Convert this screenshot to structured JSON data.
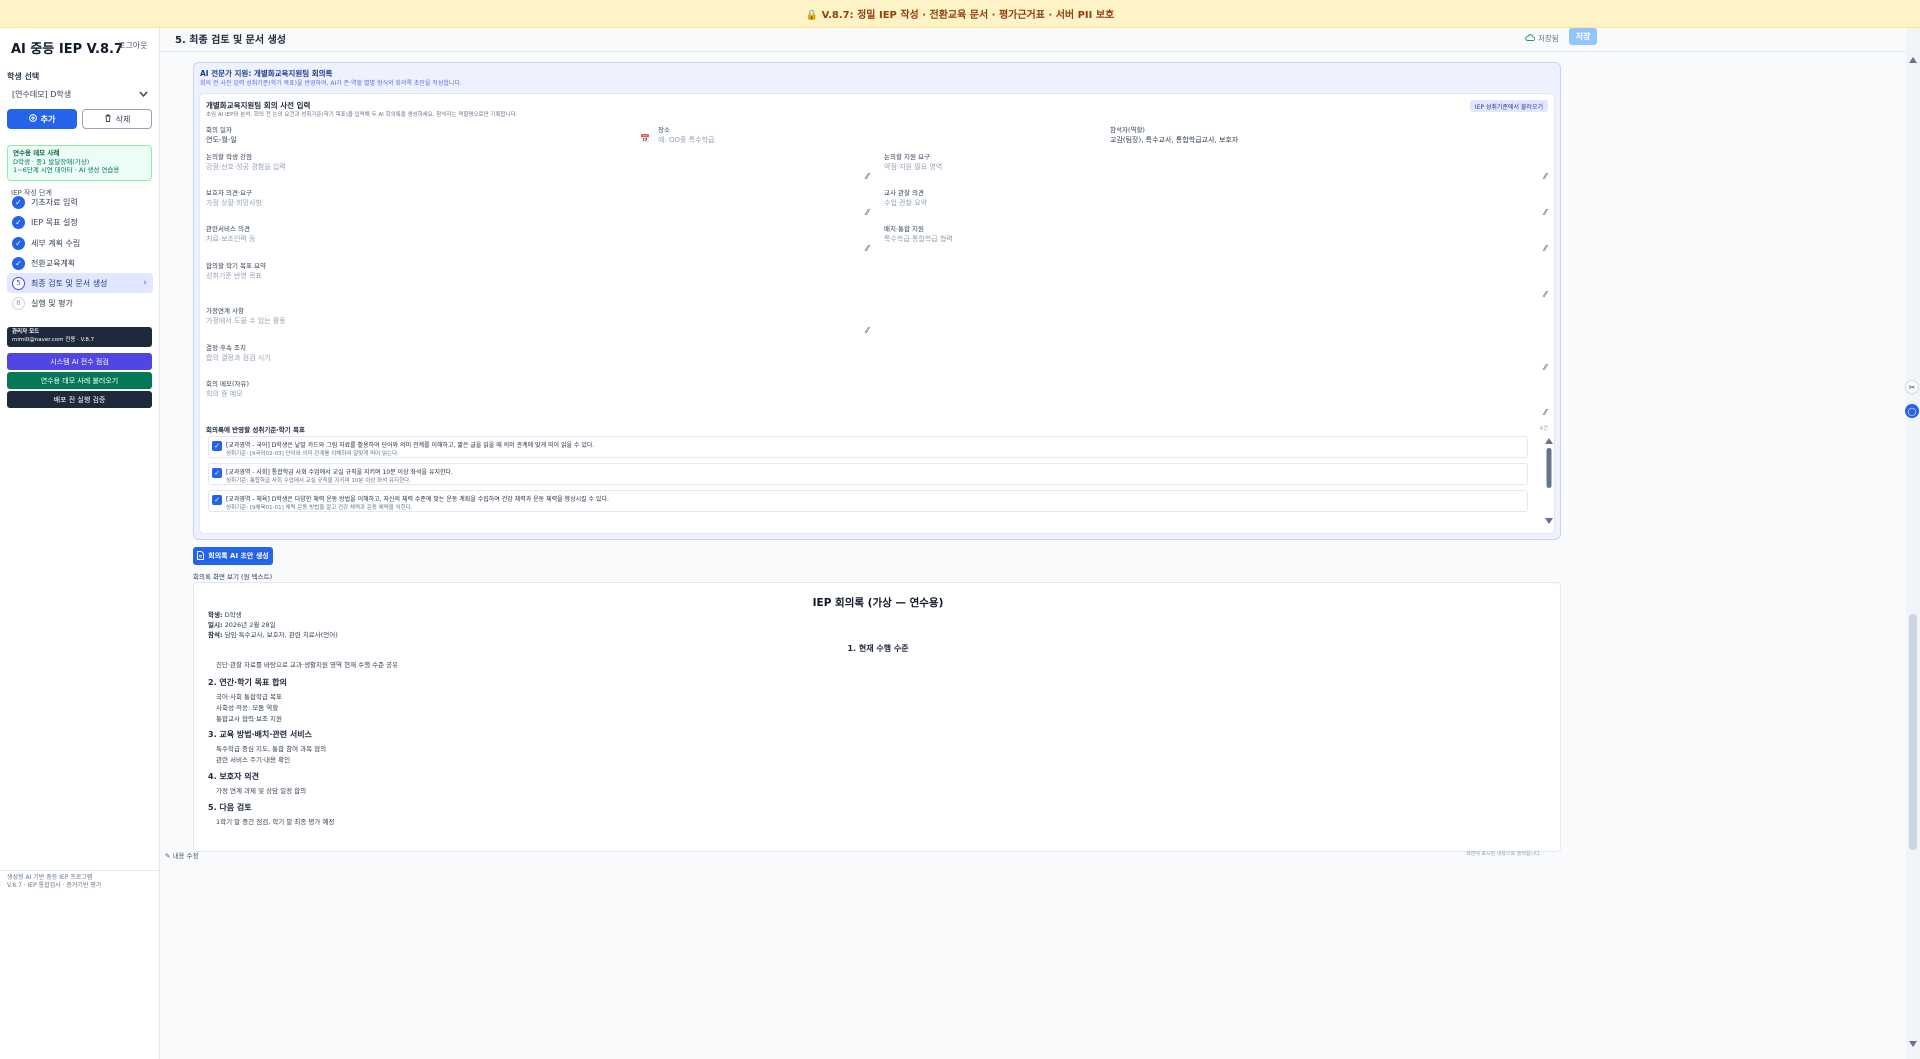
{
  "banner": {
    "text": "🔒 V.8.7: 정밀 IEP 작성 · 전환교육 문서 · 평가근거표 · 서버 PII 보호"
  },
  "sidebar": {
    "logo": "AI 중등 IEP V.8.7",
    "logout": "로그아웃",
    "student_label": "학생 선택",
    "student_value": "[연수데모] D학생",
    "add_label": "추가",
    "delete_label": "삭제",
    "demo_title": "연수용 데모 사례",
    "demo_line1": "D학생 · 중1 발달장애(가상)",
    "demo_line2": "1~6단계 시연 데이터 · AI 생성 연습용",
    "steps_label": "IEP 작성 단계",
    "steps": [
      {
        "label": "기초자료 입력",
        "num": "1"
      },
      {
        "label": "IEP 목표 설정",
        "num": "2"
      },
      {
        "label": "세부 계획 수립",
        "num": "3"
      },
      {
        "label": "전환교육계획",
        "num": "4"
      },
      {
        "label": "최종 검토 및 문서 생성",
        "num": "5"
      },
      {
        "label": "실행 및 평가",
        "num": "6"
      }
    ],
    "admin_line1": "관리자 모드",
    "admin_line2": "mimi0@naver.com 전용 · V.8.7",
    "btn_check": "시스템 AI 전수 점검",
    "btn_restore": "연수용 데모 사례 불러오기",
    "btn_test": "배포 전 실행 검증",
    "footer_line1": "생성형 AI 기반 중등 IEP 프로그램",
    "footer_line2": "V.8.7 · IEP 통합검사 · 증거기반 평가",
    "colors": {
      "primary": "#2563eb",
      "admin": "#4f46e5",
      "restore": "#047857",
      "dark": "#1e293b"
    }
  },
  "main": {
    "page_title": "5. 최종 검토 및 문서 생성",
    "saved_label": "저장됨",
    "save_button": "저장"
  },
  "assistant": {
    "title": "AI 전문가 지원: 개별화교육지원팀 회의록",
    "subtitle": "회의 전 사전 입력 성취기준(학기 목표)을 반영하여, AI가 존·역할 별별 형식의 회의록 초안을 작성합니다.",
    "card_title": "개별화교육지원팀 회의 사전 입력",
    "card_sub": "초임 AI IEP와 분석, 회의 전 논의 요건과·성취기준(학기 목표)을 입력해 두 AI 회의록을 생성하세요. 참석자는 역할명으로만 기록합니다.",
    "load_button": "IEP 성취기준에서 불러오기",
    "fields": {
      "date_label": "회의 일자",
      "date_value": "연도-월-일",
      "place_label": "장소",
      "place_placeholder": "예: OO중 특수학급",
      "attendees_label": "참석자(역할)",
      "attendees_value": "교감(팀장), 특수교사, 통합학급교사, 보호자",
      "strengths_label": "논의할 학생 강점",
      "strengths_placeholder": "강점·선호·성공 경험을 입력",
      "support_label": "논의할 지원 요구",
      "support_placeholder": "약점·지원 필요 영역",
      "guardian_label": "보호자 의견·요구",
      "guardian_placeholder": "가정 상황·희망사항",
      "teacher_label": "교사 관찰 의견",
      "teacher_placeholder": "수업·관찰 요약",
      "services_label": "관련서비스 의견",
      "services_placeholder": "치료·보조인력 등",
      "placement_label": "배치·통합 지원",
      "placement_placeholder": "특수학급·통합학급 협력",
      "goals_label": "합의할 학기 목표 요약",
      "goals_placeholder": "성취기준 반영 목표",
      "home_label": "가정연계 사항",
      "home_placeholder": "가정에서 도울 수 있는 활동",
      "decision_label": "결정·후속 조치",
      "decision_placeholder": "합의 결정과 점검 시기",
      "memo_label": "회의 메모(자유)",
      "memo_placeholder": "회의 중 메모"
    },
    "goals_title": "회의록에 반영할 성취기준·학기 목표",
    "goals_count": "4건",
    "goals": [
      {
        "line1": "[교과영역 - 국어] D학생은 낱말 카드와 그림 자료를 활용하여 단어와 의미 관계를 이해하고, 짧은 글을 읽을 때 의미 관계에 맞게 띄어 읽을 수 있다.",
        "line2": "성취기준: [9국어02-03] 단어와 의미 관계를 이해하여 알맞게 띄어 읽는다."
      },
      {
        "line1": "[교과영역 - 사회] 통합학급 사회 수업에서 교실 규칙을 지키며 10분 이상 좌석을 유지한다.",
        "line2": "성취기준: 통합학급 사회 수업에서 교실 규칙을 지키며 10분 이상 좌석 유지한다."
      },
      {
        "line1": "[교과영역 - 체육] D학생은 다양한 체력 운동 방법을 이해하고, 자신의 체력 수준에 맞는 운동 계획을 수립하여 건강 체력과 운동 체력을 향상시킬 수 있다.",
        "line2": "성취기준: [9체육01-01] 체력 운동 방법을 알고 건강 체력과 운동 체력을 익힌다."
      }
    ],
    "generate_button": "회의록 AI 초안 생성"
  },
  "preview": {
    "label": "회의록 화면 보기 (원 텍스트)",
    "title": "IEP 회의록 (가상 — 연수용)",
    "student_k": "학생:",
    "student_v": "D학생",
    "date_k": "일시:",
    "date_v": "2026년 2월 28일",
    "attend_k": "참석:",
    "attend_v": "담임·특수교사, 보호자, 관련 치료사(언어)",
    "s1": "1. 현재 수행 수준",
    "s1_item": "진단·관찰 자료를 바탕으로 교과·생활지원 영역 현재 수행 수준 공유",
    "s2": "2. 연간·학기 목표 합의",
    "s2_items": [
      "국어·사회 통합학급 목표",
      "사회성·적응: 모둠 역할",
      "통합교사 협력·보조 지원"
    ],
    "s3": "3. 교육 방법·배치·관련 서비스",
    "s3_items": [
      "특수학급 중심 지도, 통합 참여 과목 협의",
      "관련 서비스 주기·내용 확인"
    ],
    "s4": "4. 보호자 의견",
    "s4_item": "가정 연계 과제 및 상담 일정 합의",
    "s5": "5. 다음 검토",
    "s5_item": "1학기 말 중간 점검, 학기 말 최종 평가 예정",
    "edit_link": "✎ 내용 수정",
    "foot_note": "화면에 표시된 내용으로 출력됩니다"
  }
}
